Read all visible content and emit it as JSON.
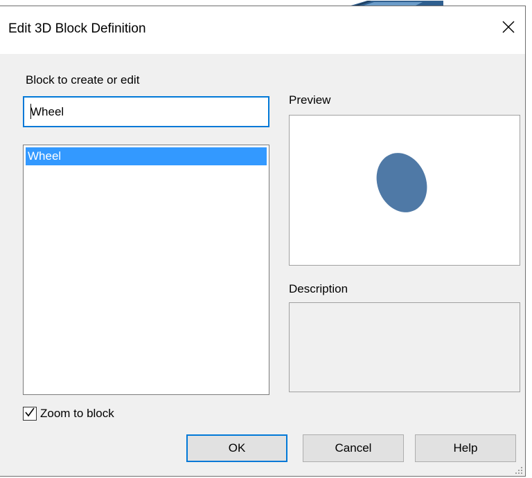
{
  "dialog": {
    "title": "Edit 3D Block Definition",
    "close_icon": "close-icon"
  },
  "block": {
    "label": "Block to create or edit",
    "name_value": "Wheel",
    "list_items": [
      "Wheel"
    ],
    "selected_index": 0
  },
  "preview": {
    "label": "Preview",
    "shape_color": "#4f79a6"
  },
  "description": {
    "label": "Description",
    "value": ""
  },
  "options": {
    "zoom_label": "Zoom to block",
    "zoom_checked": true
  },
  "buttons": {
    "ok": "OK",
    "cancel": "Cancel",
    "help": "Help"
  },
  "colors": {
    "accent": "#0078d7",
    "selection": "#3399ff"
  }
}
